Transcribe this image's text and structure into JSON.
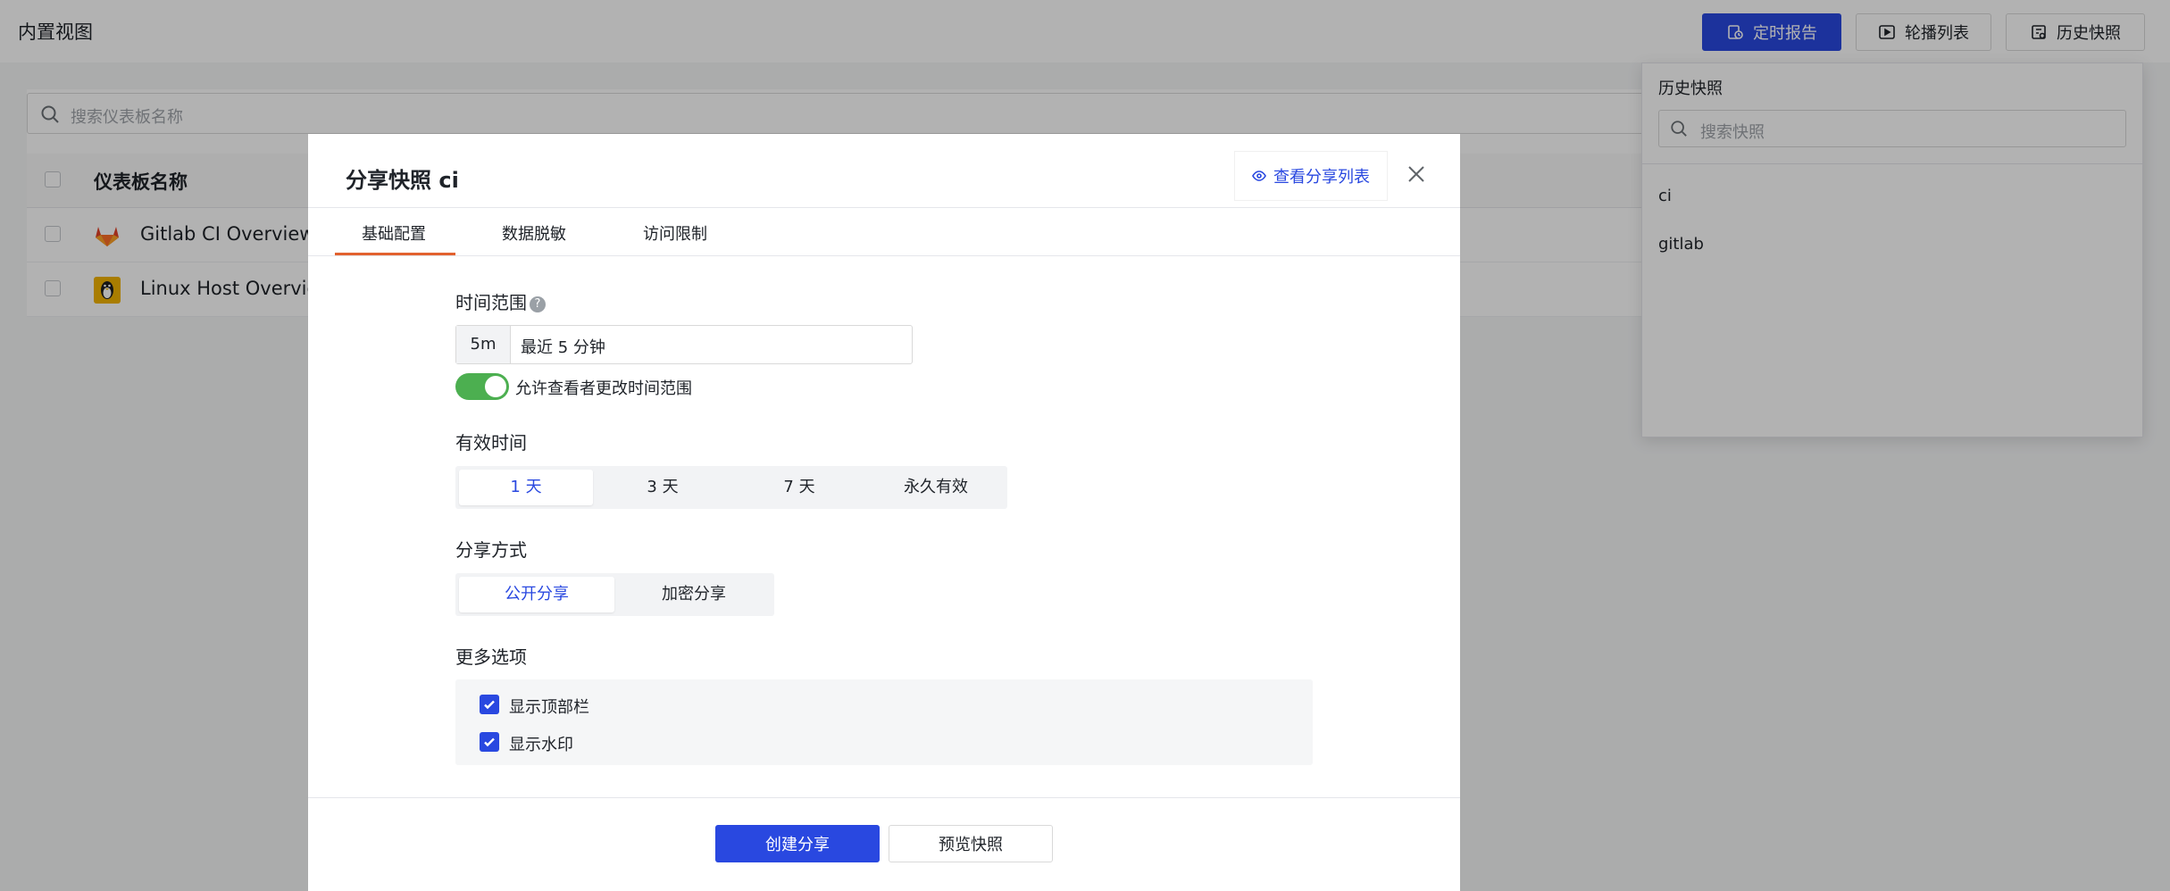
{
  "page": {
    "title": "内置视图",
    "buttons": {
      "scheduled_report": "定时报告",
      "carousel_list": "轮播列表",
      "history_snapshot": "历史快照"
    },
    "search_placeholder": "搜索仪表板名称",
    "table": {
      "column_name": "仪表板名称",
      "rows": [
        {
          "name": "Gitlab CI Overview",
          "icon": "gitlab-icon"
        },
        {
          "name": "Linux Host Overvie",
          "icon": "linux-icon"
        }
      ]
    }
  },
  "history_panel": {
    "title": "历史快照",
    "search_placeholder": "搜索快照",
    "items": [
      "ci",
      "gitlab"
    ]
  },
  "modal": {
    "title": "分享快照 ci",
    "view_share_list": "查看分享列表",
    "tabs": [
      "基础配置",
      "数据脱敏",
      "访问限制"
    ],
    "active_tab": "基础配置",
    "time_range": {
      "label": "时间范围",
      "help": "?",
      "prefix": "5m",
      "value": "最近 5 分钟",
      "allow_change_label": "允许查看者更改时间范围",
      "allow_change": true
    },
    "validity": {
      "label": "有效时间",
      "options": [
        "1 天",
        "3 天",
        "7 天",
        "永久有效"
      ],
      "selected": "1 天"
    },
    "share_mode": {
      "label": "分享方式",
      "options": [
        "公开分享",
        "加密分享"
      ],
      "selected": "公开分享"
    },
    "more_options": {
      "label": "更多选项",
      "items": [
        {
          "label": "显示顶部栏",
          "checked": true
        },
        {
          "label": "显示水印",
          "checked": true
        }
      ]
    },
    "footer": {
      "create": "创建分享",
      "preview": "预览快照"
    }
  },
  "colors": {
    "primary": "#2948e0",
    "tab_underline": "#e2612e",
    "toggle_on": "#4caf50"
  }
}
